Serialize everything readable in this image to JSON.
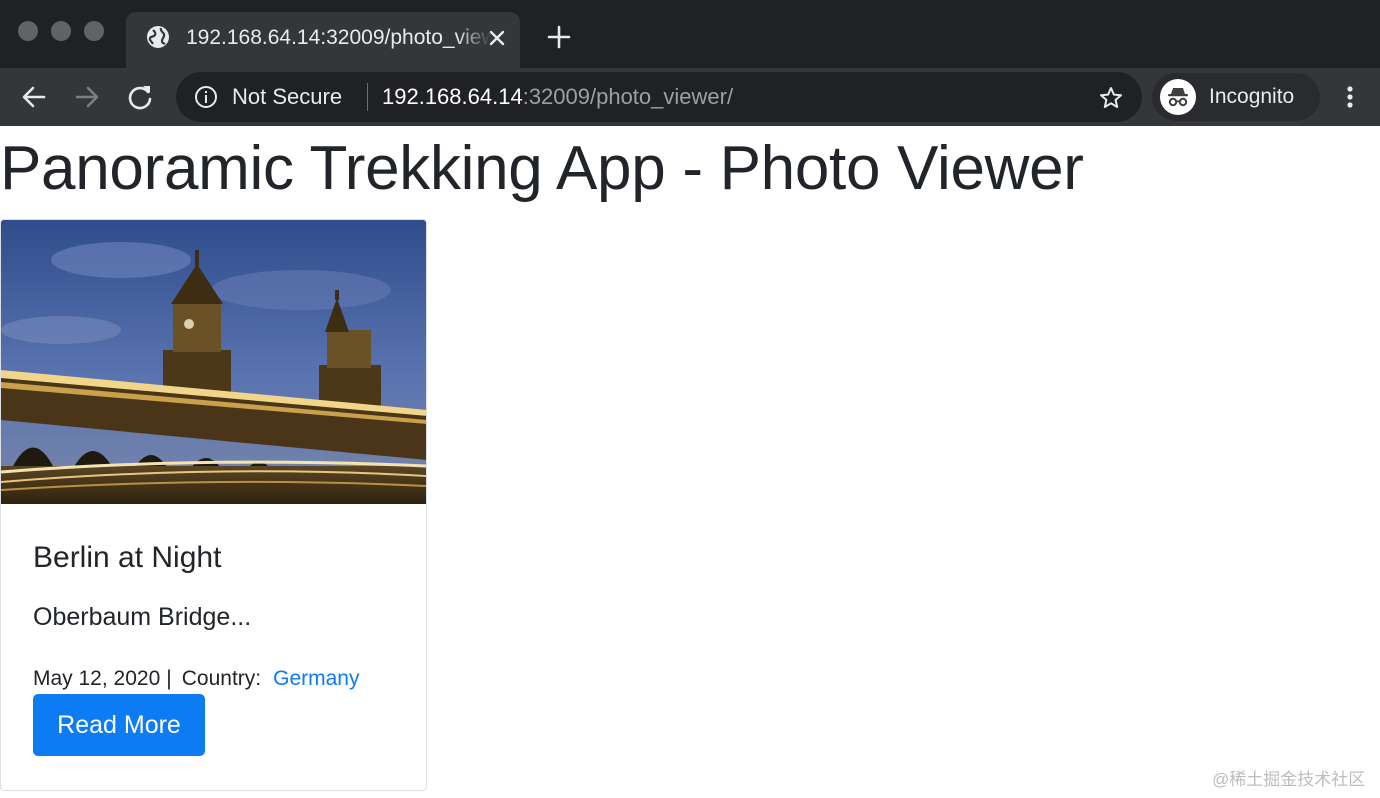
{
  "browser": {
    "tab": {
      "title": "192.168.64.14:32009/photo_viewer/",
      "icon": "globe-icon",
      "close_icon": "close-icon"
    },
    "new_tab_icon": "plus-icon",
    "nav": {
      "back_icon": "back-arrow-icon",
      "forward_icon": "forward-arrow-icon",
      "reload_icon": "reload-icon"
    },
    "address_bar": {
      "security_icon": "info-icon",
      "security_label": "Not Secure",
      "url_host": "192.168.64.14",
      "url_rest": ":32009/photo_viewer/",
      "bookmark_icon": "star-icon"
    },
    "profile": {
      "icon": "incognito-icon",
      "label": "Incognito"
    },
    "menu_icon": "kebab-menu-icon"
  },
  "page": {
    "title": "Panoramic Trekking App - Photo Viewer",
    "cards": [
      {
        "title": "Berlin at Night",
        "excerpt": "Oberbaum Bridge...",
        "date": "May 12, 2020",
        "separator": "|",
        "country_label": "Country:",
        "country": "Germany",
        "button_label": "Read More"
      }
    ]
  },
  "watermark": "@稀土掘金技术社区",
  "colors": {
    "chrome_dark": "#202124",
    "chrome_toolbar": "#35363a",
    "primary": "#0d7bf2",
    "text": "#212529"
  }
}
